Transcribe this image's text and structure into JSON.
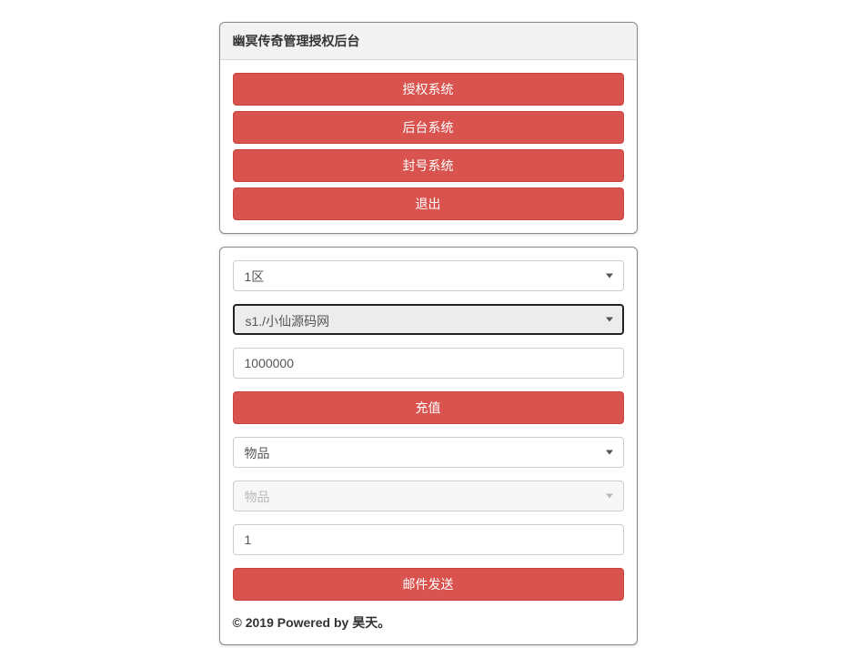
{
  "panel1": {
    "title": "幽冥传奇管理授权后台",
    "buttons": {
      "auth": "授权系统",
      "backend": "后台系统",
      "ban": "封号系统",
      "exit": "退出"
    }
  },
  "panel2": {
    "zoneSelect": "1区",
    "serverSelect": "s1./小仙源码网",
    "amountValue": "1000000",
    "rechargeBtn": "充值",
    "itemSelect1": "物品",
    "itemSelect2": "物品",
    "quantityValue": "1",
    "mailSendBtn": "邮件发送",
    "footer": "© 2019 Powered by 昊天。"
  }
}
